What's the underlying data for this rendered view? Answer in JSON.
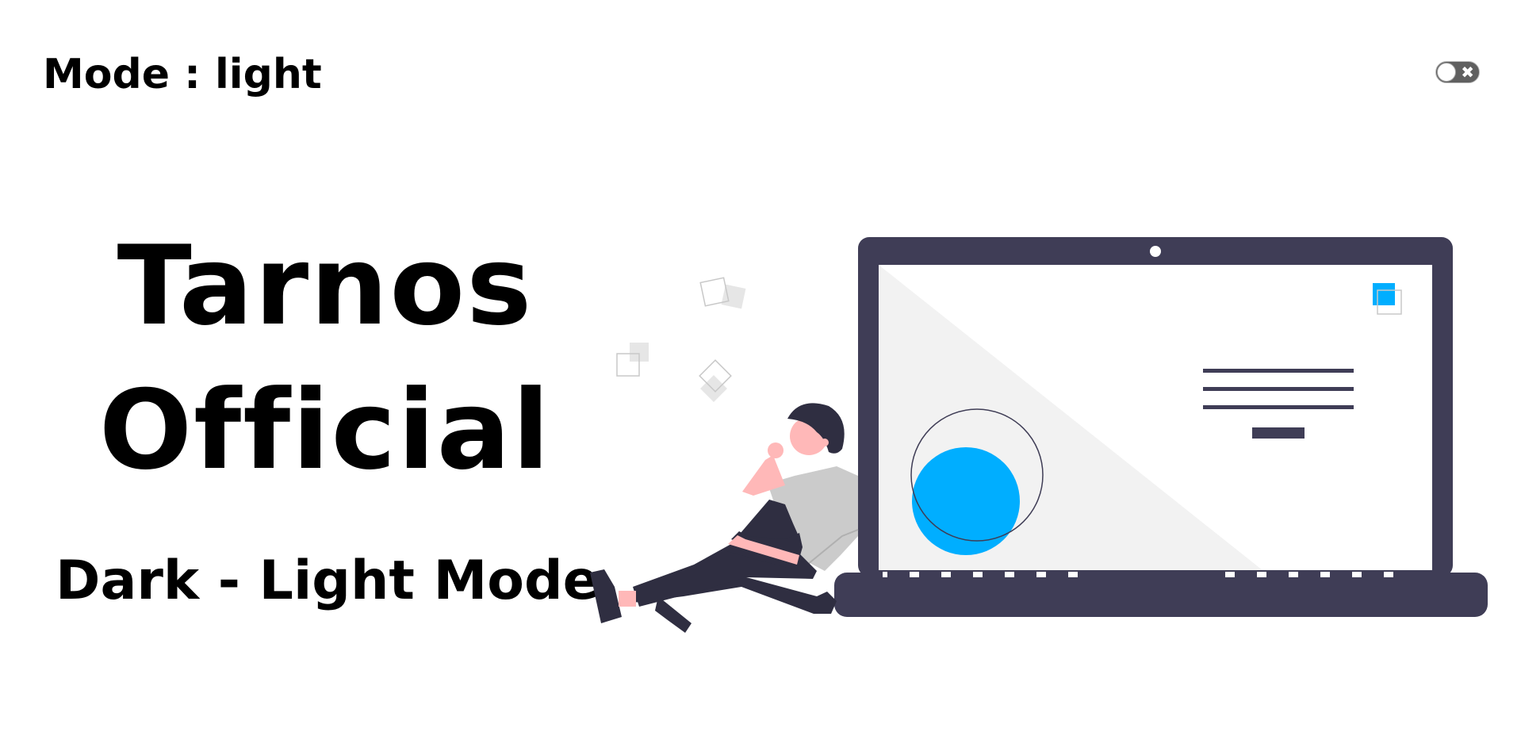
{
  "header": {
    "mode_label": "Mode : light",
    "toggle": {
      "state": "off",
      "icon": "close-icon",
      "glyph": "✖"
    }
  },
  "hero": {
    "title_line1": "Tarnos",
    "title_line2": "Official",
    "subtitle": "Dark - Light Mode"
  },
  "illustration": {
    "subject": "person-sitting-by-laptop",
    "colors": {
      "laptop": "#3f3d56",
      "screen": "#ffffff",
      "screen_shade": "#f2f2f2",
      "accent": "#00aeff",
      "skin": "#ffb8b8",
      "shirt": "#cbcbcb",
      "pants": "#2f2e41",
      "outline": "#3f3d56",
      "deco": "#e6e6e6"
    }
  }
}
